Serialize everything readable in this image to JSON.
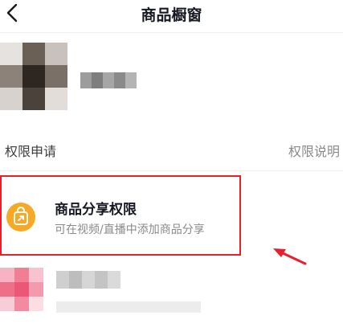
{
  "nav": {
    "title": "商品橱窗",
    "back_icon": "chevron-left-icon"
  },
  "profile": {
    "avatar": "pixelated-avatar",
    "nickname": "pixelated-nickname"
  },
  "section": {
    "label": "权限申请",
    "link": "权限说明"
  },
  "permission_card": {
    "icon": "shopping-bag-share-icon",
    "title": "商品分享权限",
    "description": "可在视频/直播中添加商品分享",
    "highlight_color": "#e8202b",
    "icon_color": "#f7a824"
  },
  "annotation": {
    "arrow_color": "#e8202b"
  },
  "next_item": {
    "icon": "pixelated-icon"
  }
}
